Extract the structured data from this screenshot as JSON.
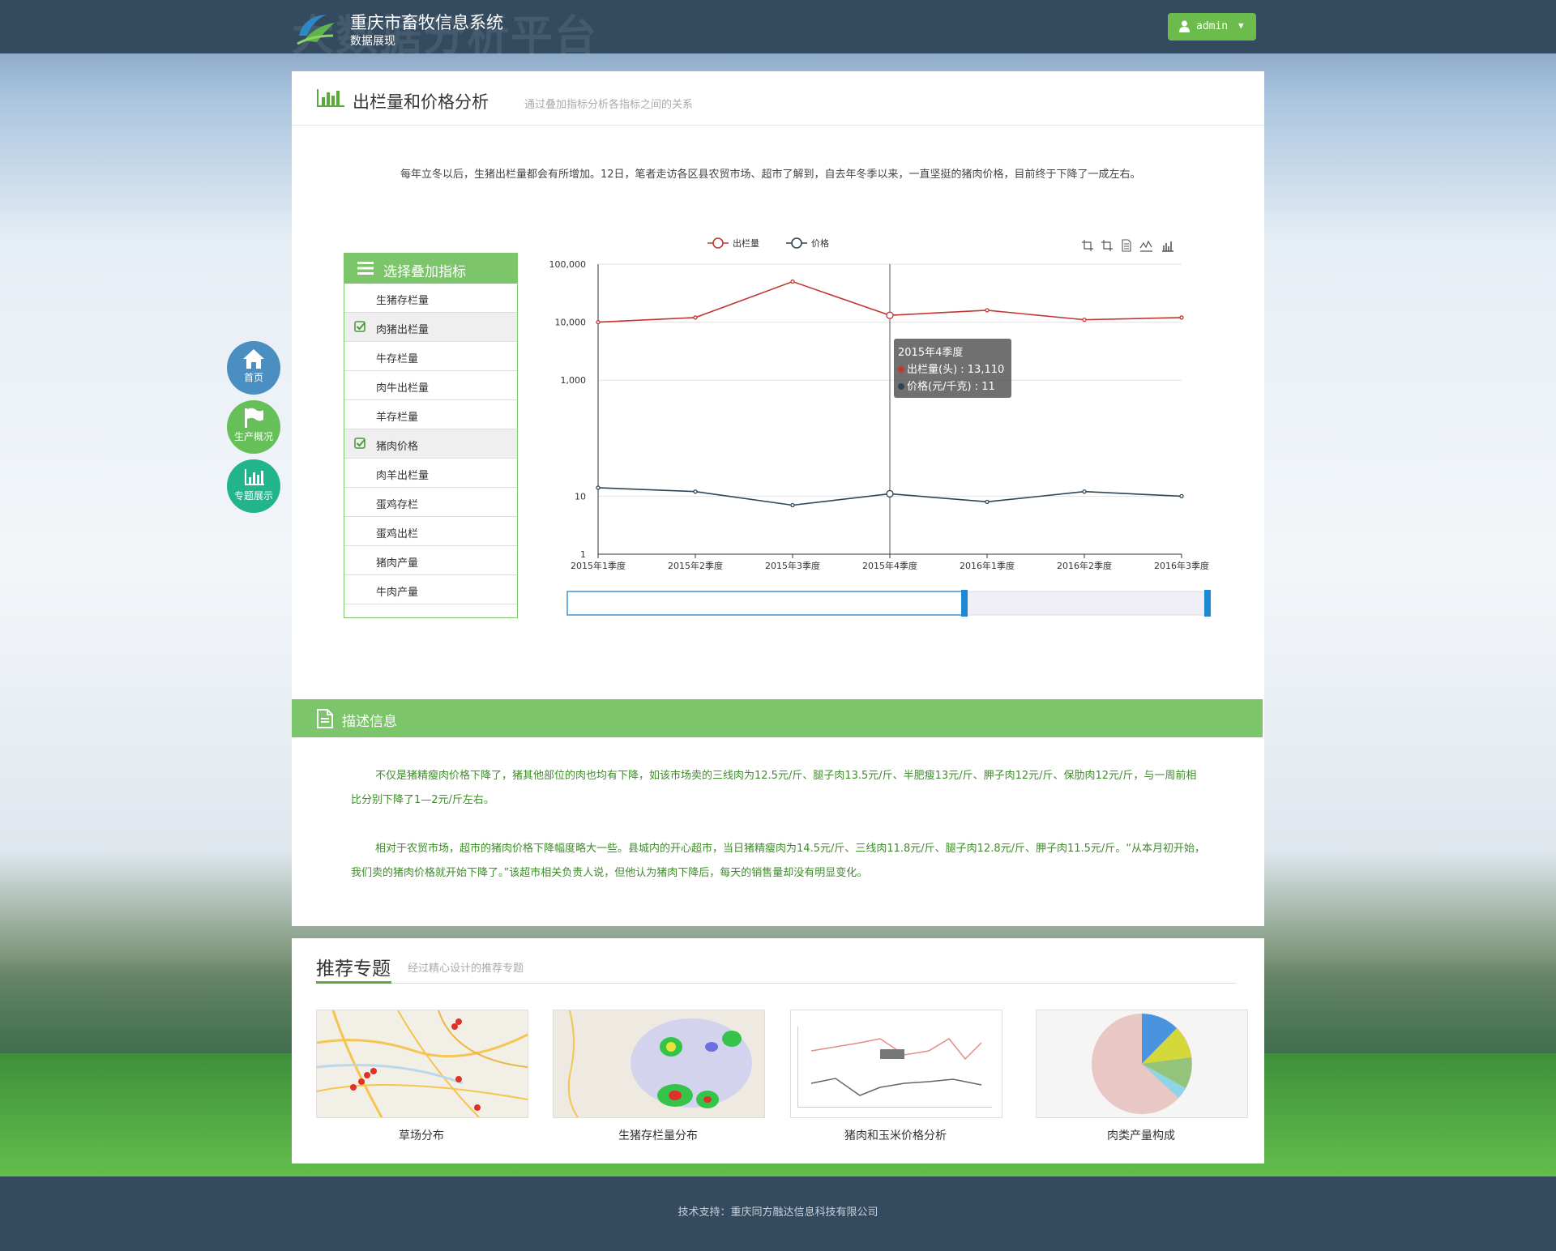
{
  "header": {
    "title": "重庆市畜牧信息系统",
    "subtitle": "数据展现",
    "user": "admin",
    "ghost_text": "大数据分析平台"
  },
  "side_nav": [
    {
      "label": "首页",
      "icon": "home-icon",
      "color": "#4a8ec2"
    },
    {
      "label": "生产概况",
      "icon": "flag-icon",
      "color": "#66bf58"
    },
    {
      "label": "专题展示",
      "icon": "bar-chart-icon",
      "color": "#22b58c"
    }
  ],
  "main": {
    "title": "出栏量和价格分析",
    "subtitle": "通过叠加指标分析各指标之间的关系",
    "intro": "每年立冬以后，生猪出栏量都会有所增加。12日，笔者走访各区县农贸市场、超市了解到，自去年冬季以来，一直坚挺的猪肉价格，目前终于下降了一成左右。"
  },
  "indicators": {
    "title": "选择叠加指标",
    "items": [
      {
        "label": "生猪存栏量",
        "checked": false
      },
      {
        "label": "肉猪出栏量",
        "checked": true
      },
      {
        "label": "牛存栏量",
        "checked": false
      },
      {
        "label": "肉牛出栏量",
        "checked": false
      },
      {
        "label": "羊存栏量",
        "checked": false
      },
      {
        "label": "猪肉价格",
        "checked": true
      },
      {
        "label": "肉羊出栏量",
        "checked": false
      },
      {
        "label": "蛋鸡存栏",
        "checked": false
      },
      {
        "label": "蛋鸡出栏",
        "checked": false
      },
      {
        "label": "猪肉产量",
        "checked": false
      },
      {
        "label": "牛肉产量",
        "checked": false
      }
    ]
  },
  "chart_data": {
    "type": "line",
    "x": [
      "2015年1季度",
      "2015年2季度",
      "2015年3季度",
      "2015年4季度",
      "2016年1季度",
      "2016年2季度",
      "2016年3季度"
    ],
    "series": [
      {
        "name": "出栏量",
        "values": [
          10000,
          12000,
          50000,
          13110,
          16000,
          11000,
          12000
        ],
        "color": "#c23531"
      },
      {
        "name": "价格",
        "values": [
          14,
          12,
          7,
          11,
          8,
          12,
          10
        ],
        "color": "#2f4554"
      }
    ],
    "y_scale": "log",
    "y_ticks": [
      "1",
      "10",
      "1,000",
      "10,000",
      "100,000"
    ],
    "ylim": [
      1,
      100000
    ],
    "legend": "top-center",
    "tooltip": {
      "title": "2015年4季度",
      "rows": [
        "出栏量(头) : 13,110",
        "价格(元/千克) : 11"
      ]
    }
  },
  "description": {
    "title": "描述信息",
    "p1": "不仅是猪精瘦肉价格下降了，猪其他部位的肉也均有下降，如该市场卖的三线肉为12.5元/斤、腿子肉13.5元/斤、半肥瘦13元/斤、胛子肉12元/斤、保肋肉12元/斤，与一周前相比分别下降了1—2元/斤左右。",
    "p2": "相对于农贸市场，超市的猪肉价格下降幅度略大一些。县城内的开心超市，当日猪精瘦肉为14.5元/斤、三线肉11.8元/斤、腿子肉12.8元/斤、胛子肉11.5元/斤。“从本月初开始，我们卖的猪肉价格就开始下降了。”该超市相关负责人说，但他认为猪肉下降后，每天的销售量却没有明显变化。"
  },
  "recommend": {
    "title": "推荐专题",
    "subtitle": "经过精心设计的推荐专题",
    "cards": [
      {
        "label": "草场分布"
      },
      {
        "label": "生猪存栏量分布"
      },
      {
        "label": "猪肉和玉米价格分析"
      },
      {
        "label": "肉类产量构成"
      }
    ]
  },
  "footer": {
    "text": "技术支持：重庆同方融达信息科技有限公司"
  },
  "colors": {
    "header": "#344a5f",
    "accent_green": "#7cc56a",
    "button_green": "#6cbb4d"
  }
}
